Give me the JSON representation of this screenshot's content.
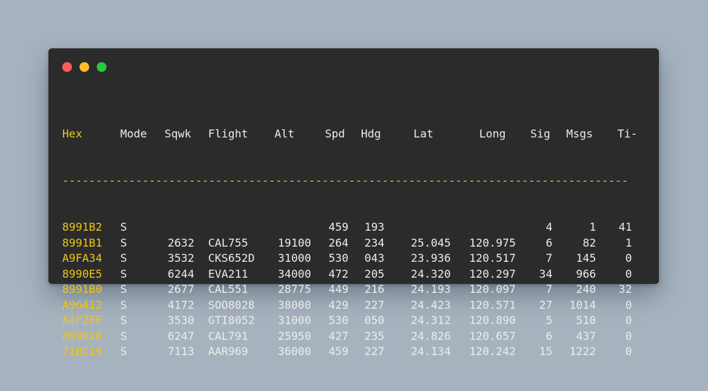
{
  "window": {
    "controls": {
      "close_color": "#ff5f56",
      "minimize_color": "#ffbd2e",
      "maximize_color": "#27c93f"
    }
  },
  "terminal": {
    "headers": {
      "hex": "Hex",
      "mode": "Mode",
      "sqwk": "Sqwk",
      "flight": "Flight",
      "alt": "Alt",
      "spd": "Spd",
      "hdg": "Hdg",
      "lat": "Lat",
      "long": "Long",
      "sig": "Sig",
      "msgs": "Msgs",
      "ti": "Ti-"
    },
    "separator": "-------------------------------------------------------------------------------------",
    "rows": [
      {
        "hex": "8991B2",
        "mode": "S",
        "sqwk": "",
        "flight": "",
        "alt": "",
        "spd": "459",
        "hdg": "193",
        "lat": "",
        "long": "",
        "sig": "4",
        "msgs": "1",
        "ti": "41"
      },
      {
        "hex": "8991B1",
        "mode": "S",
        "sqwk": "2632",
        "flight": "CAL755",
        "alt": "19100",
        "spd": "264",
        "hdg": "234",
        "lat": "25.045",
        "long": "120.975",
        "sig": "6",
        "msgs": "82",
        "ti": "1"
      },
      {
        "hex": "A9FA34",
        "mode": "S",
        "sqwk": "3532",
        "flight": "CKS652D",
        "alt": "31000",
        "spd": "530",
        "hdg": "043",
        "lat": "23.936",
        "long": "120.517",
        "sig": "7",
        "msgs": "145",
        "ti": "0"
      },
      {
        "hex": "8990E5",
        "mode": "S",
        "sqwk": "6244",
        "flight": "EVA211",
        "alt": "34000",
        "spd": "472",
        "hdg": "205",
        "lat": "24.320",
        "long": "120.297",
        "sig": "34",
        "msgs": "966",
        "ti": "0"
      },
      {
        "hex": "8991B0",
        "mode": "S",
        "sqwk": "2677",
        "flight": "CAL551",
        "alt": "28775",
        "spd": "449",
        "hdg": "216",
        "lat": "24.193",
        "long": "120.097",
        "sig": "7",
        "msgs": "240",
        "ti": "32"
      },
      {
        "hex": "A96412",
        "mode": "S",
        "sqwk": "4172",
        "flight": "SOO8028",
        "alt": "38000",
        "spd": "429",
        "hdg": "227",
        "lat": "24.423",
        "long": "120.571",
        "sig": "27",
        "msgs": "1014",
        "ti": "0"
      },
      {
        "hex": "A4F2EE",
        "mode": "S",
        "sqwk": "3530",
        "flight": "GTI8052",
        "alt": "31000",
        "spd": "530",
        "hdg": "050",
        "lat": "24.312",
        "long": "120.890",
        "sig": "5",
        "msgs": "510",
        "ti": "0"
      },
      {
        "hex": "899020",
        "mode": "S",
        "sqwk": "6247",
        "flight": "CAL791",
        "alt": "25950",
        "spd": "427",
        "hdg": "235",
        "lat": "24.826",
        "long": "120.657",
        "sig": "6",
        "msgs": "437",
        "ti": "0"
      },
      {
        "hex": "71BC19",
        "mode": "S",
        "sqwk": "7113",
        "flight": "AAR969",
        "alt": "36000",
        "spd": "459",
        "hdg": "227",
        "lat": "24.134",
        "long": "120.242",
        "sig": "15",
        "msgs": "1222",
        "ti": "0"
      }
    ]
  }
}
